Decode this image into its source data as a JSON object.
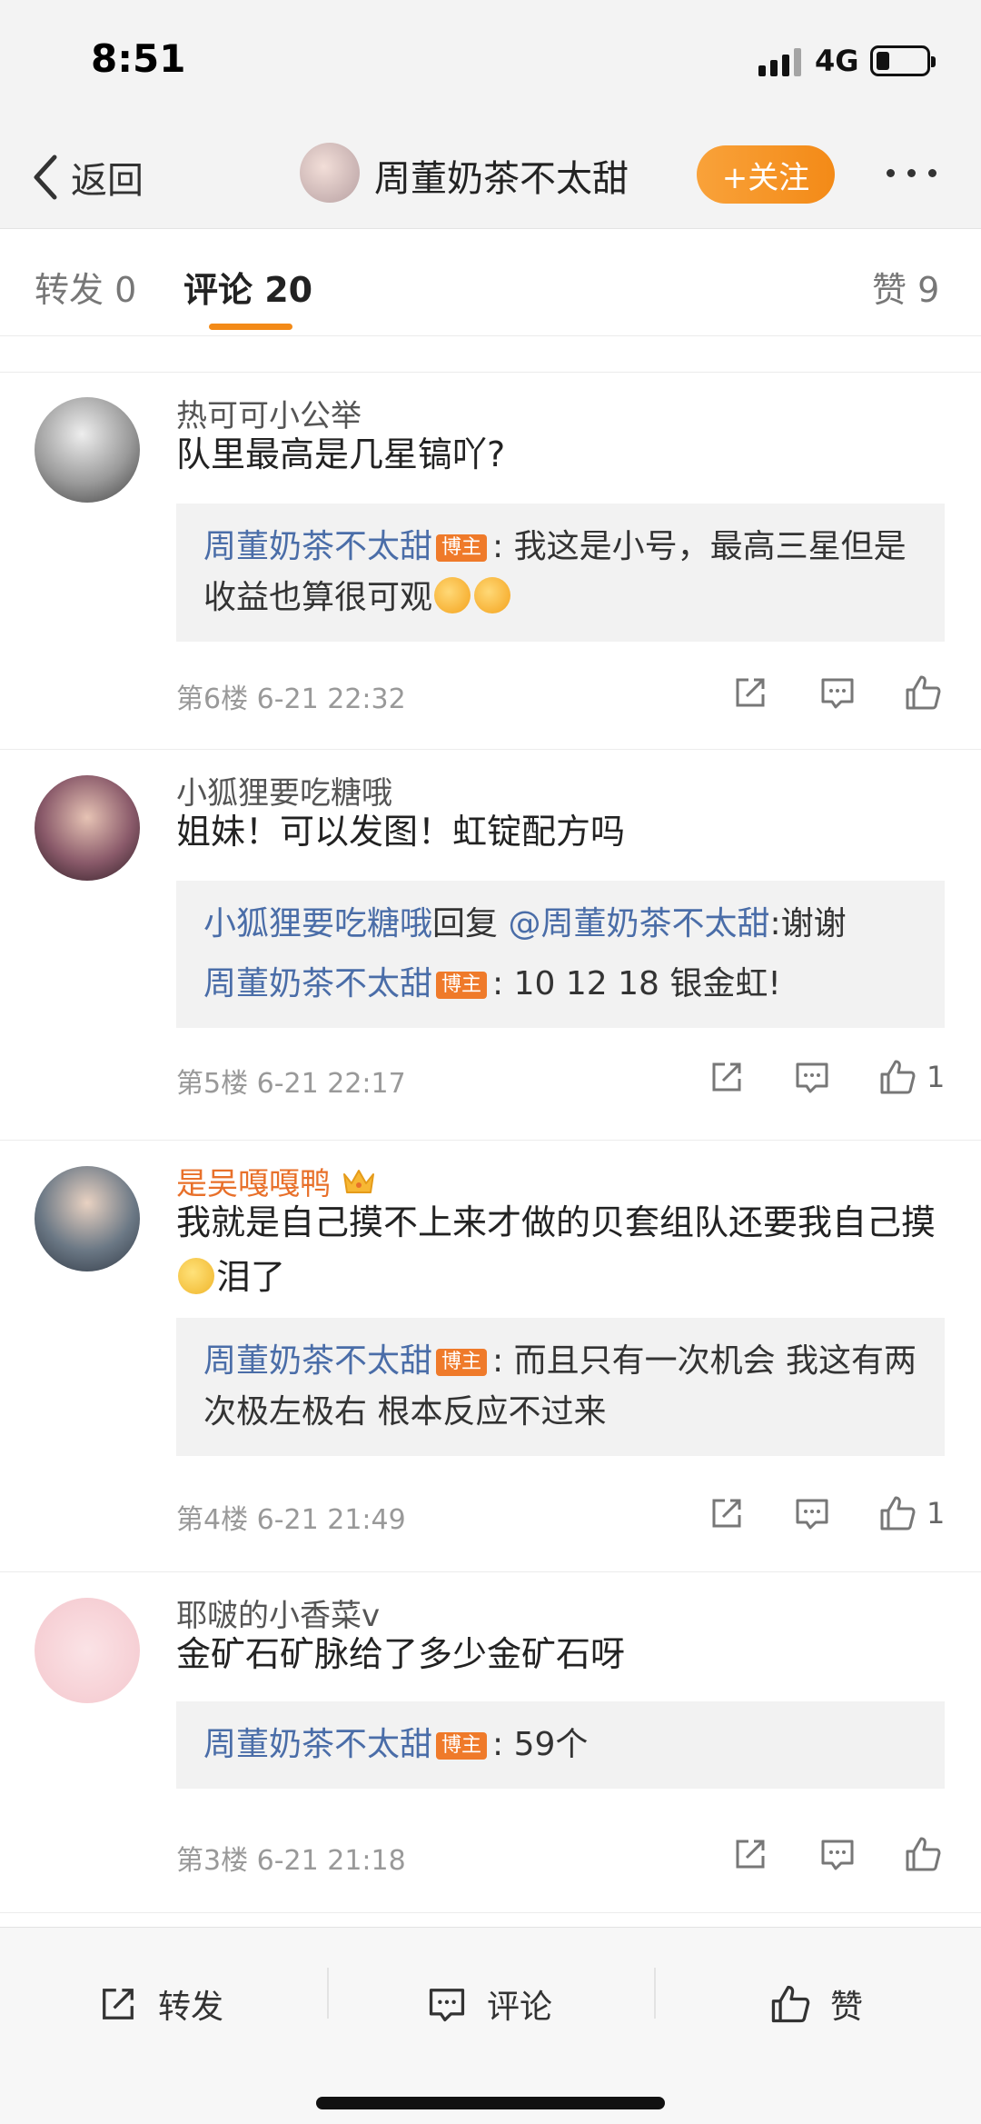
{
  "status_bar": {
    "time": "8:51",
    "network": "4G"
  },
  "nav": {
    "back_label": "返回",
    "title": "周董奶茶不太甜",
    "follow_label": "+关注"
  },
  "tabs": [
    {
      "label": "转发 0"
    },
    {
      "label": "评论 20"
    },
    {
      "label": "赞 9"
    }
  ],
  "comments": [
    {
      "name": "热可可小公举",
      "text": "队里最高是几星镐吖?",
      "replies": [
        {
          "user": "周董奶茶不太甜",
          "badge": "博主",
          "text": ": 我这是小号，最高三星但是收益也算很可观"
        }
      ],
      "meta": "第6楼 6-21 22:32",
      "likes": ""
    },
    {
      "name": "小狐狸要吃糖哦",
      "text": "姐妹！可以发图！虹锭配方吗",
      "replies": [
        {
          "user": "小狐狸要吃糖哦",
          "mid": "回复",
          "mention": "@周董奶茶不太甜",
          "text": ":谢谢"
        },
        {
          "user": "周董奶茶不太甜",
          "badge": "博主",
          "text": ": 10 12 18 银金虹!"
        }
      ],
      "meta": "第5楼 6-21 22:17",
      "likes": "1"
    },
    {
      "name": "是吴嘎嘎鸭",
      "text_a": "我就是自己摸不上来才做的贝套组队还要我自己摸",
      "text_b": "泪了",
      "replies": [
        {
          "user": "周董奶茶不太甜",
          "badge": "博主",
          "text": ": 而且只有一次机会 我这有两次极左极右 根本反应不过来"
        }
      ],
      "meta": "第4楼 6-21 21:49",
      "likes": "1"
    },
    {
      "name": "耶啵的小香菜v",
      "text": "金矿石矿脉给了多少金矿石呀",
      "replies": [
        {
          "user": "周董奶茶不太甜",
          "badge": "博主",
          "text": ": 59个"
        }
      ],
      "meta": "第3楼 6-21 21:18",
      "likes": ""
    }
  ],
  "bottom_bar": {
    "repost": "转发",
    "comment": "评论",
    "like": "赞"
  },
  "colors": {
    "accent": "#f38a17",
    "link": "#4a6da8",
    "badge": "#ef7a2a",
    "vip_name": "#e8702a"
  },
  "icons": [
    "back-chevron-icon",
    "share-icon",
    "comment-icon",
    "thumbs-up-icon",
    "crown-icon",
    "blush-emoji-icon",
    "sad-emoji-icon"
  ]
}
